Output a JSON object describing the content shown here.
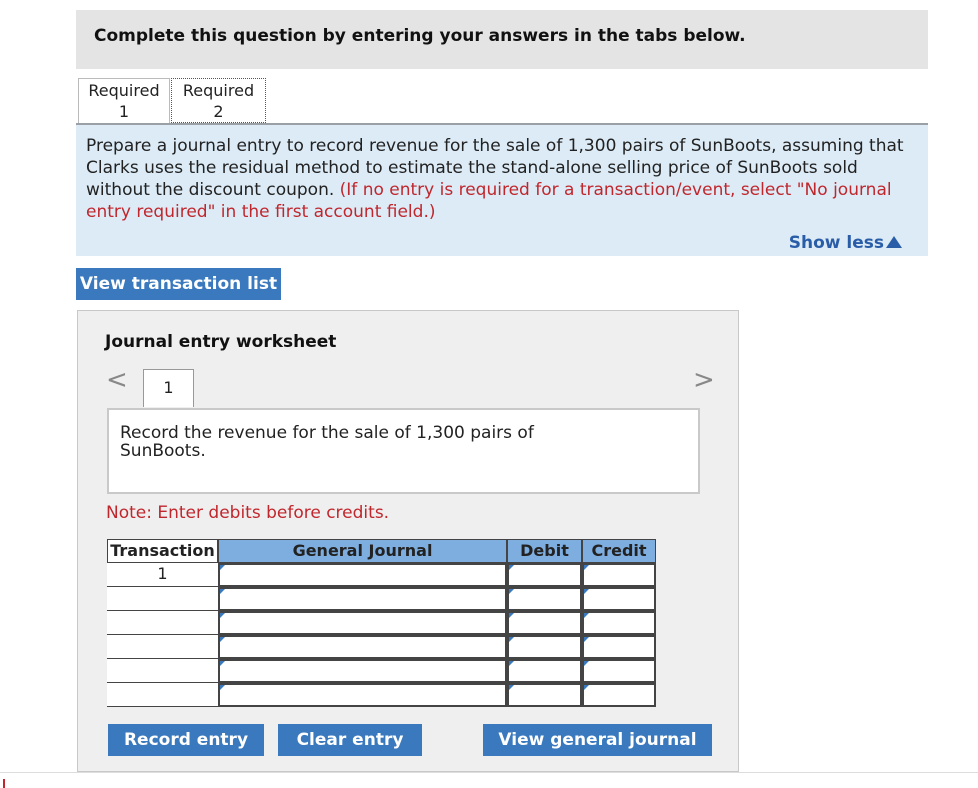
{
  "header": {
    "title": "Complete this question by entering your answers in the tabs below."
  },
  "tabs": [
    {
      "line1": "Required",
      "line2": "1"
    },
    {
      "line1": "Required",
      "line2": "2"
    }
  ],
  "instructions": {
    "main": "Prepare a journal entry to record revenue for the sale of 1,300 pairs of SunBoots, assuming that Clarks uses the residual method to estimate the stand-alone selling price of SunBoots sold without the discount coupon.",
    "red": "(If no entry is required for a transaction/event, select \"No journal entry required\" in the first account field.)",
    "show_less": "Show less"
  },
  "view_transaction_list": "View transaction list",
  "worksheet": {
    "title": "Journal entry worksheet",
    "nav_prev": "<",
    "nav_next": ">",
    "page": "1",
    "description": "Record the revenue for the sale of 1,300 pairs of SunBoots.",
    "note": "Note: Enter debits before credits.",
    "columns": {
      "transaction": "Transaction",
      "general_journal": "General Journal",
      "debit": "Debit",
      "credit": "Credit"
    },
    "rows": [
      {
        "transaction": "1"
      },
      {
        "transaction": ""
      },
      {
        "transaction": ""
      },
      {
        "transaction": ""
      },
      {
        "transaction": ""
      },
      {
        "transaction": ""
      }
    ],
    "buttons": {
      "record": "Record entry",
      "clear": "Clear entry",
      "view_journal": "View general journal"
    }
  },
  "colors": {
    "accent": "#3a79bd",
    "note_red": "#c0272d",
    "header_blue": "#7eaee0",
    "instr_bg": "#dcebf6"
  }
}
